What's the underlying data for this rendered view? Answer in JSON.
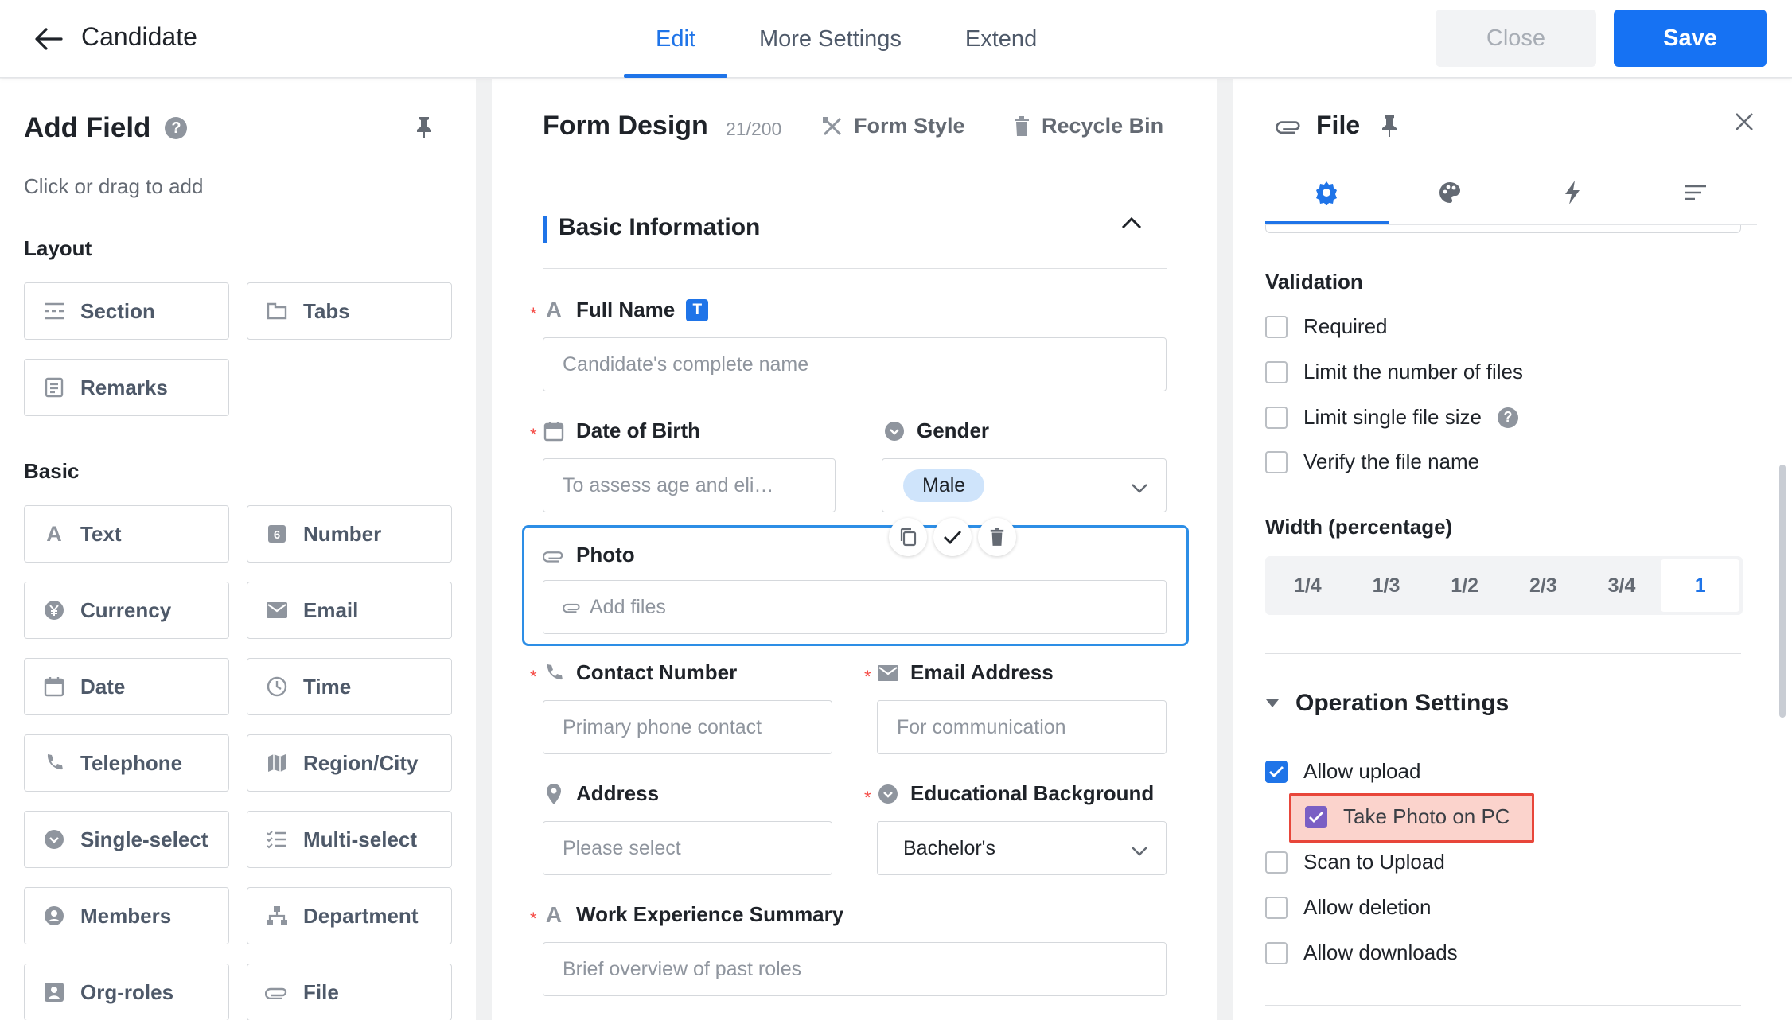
{
  "header": {
    "title": "Candidate",
    "tabs": [
      "Edit",
      "More Settings",
      "Extend"
    ],
    "close_label": "Close",
    "save_label": "Save"
  },
  "add_field": {
    "title": "Add Field",
    "hint": "Click or drag to add",
    "layout_title": "Layout",
    "layout_items": [
      "Section",
      "Tabs",
      "Remarks"
    ],
    "basic_title": "Basic",
    "basic_items": [
      "Text",
      "Number",
      "Currency",
      "Email",
      "Date",
      "Time",
      "Telephone",
      "Region/City",
      "Single-select",
      "Multi-select",
      "Members",
      "Department",
      "Org-roles",
      "File"
    ]
  },
  "form_design": {
    "title": "Form Design",
    "count": "21/200",
    "form_style": "Form Style",
    "recycle_bin": "Recycle Bin",
    "section_title": "Basic Information",
    "fields": {
      "full_name": {
        "label": "Full Name",
        "badge": "T",
        "placeholder": "Candidate's complete name"
      },
      "dob": {
        "label": "Date of Birth",
        "placeholder": "To assess age and eli…"
      },
      "gender": {
        "label": "Gender",
        "value": "Male"
      },
      "photo": {
        "label": "Photo",
        "placeholder": "Add files"
      },
      "contact": {
        "label": "Contact Number",
        "placeholder": "Primary phone contact"
      },
      "email": {
        "label": "Email Address",
        "placeholder": "For communication"
      },
      "address": {
        "label": "Address",
        "placeholder": "Please select"
      },
      "education": {
        "label": "Educational Background",
        "value": "Bachelor's"
      },
      "work": {
        "label": "Work Experience Summary",
        "placeholder": "Brief overview of past roles"
      }
    }
  },
  "properties": {
    "title": "File",
    "validation_title": "Validation",
    "validation": [
      "Required",
      "Limit the number of files",
      "Limit single file size",
      "Verify the file name"
    ],
    "width_title": "Width (percentage)",
    "widths": [
      "1/4",
      "1/3",
      "1/2",
      "2/3",
      "3/4",
      "1"
    ],
    "width_selected": "1",
    "operation_title": "Operation Settings",
    "operations": [
      {
        "label": "Allow upload",
        "checked": true
      },
      {
        "label": "Take Photo on PC",
        "checked": true
      },
      {
        "label": "Scan to Upload",
        "checked": false
      },
      {
        "label": "Allow deletion",
        "checked": false
      },
      {
        "label": "Allow downloads",
        "checked": false
      }
    ]
  },
  "colors": {
    "accent": "#1f74e8",
    "save": "#1672f3",
    "required": "#f54a45",
    "highlight_border": "#e8463a",
    "highlight_fill": "#fbd3cc"
  }
}
